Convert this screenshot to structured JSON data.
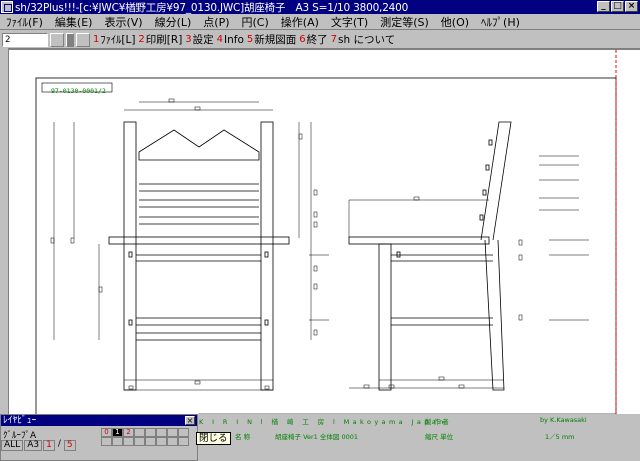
{
  "titlebar": {
    "title": "sh/32Plus!!!-[c:¥JWC¥楢野工房¥97_0130.JWC]胡座椅子　A3 S=1/10 3800,2400",
    "buttons": [
      "_",
      "□",
      "×"
    ]
  },
  "menu": [
    "ﾌｧｲﾙ(F)",
    "編集(E)",
    "表示(V)",
    "線分(L)",
    "点(P)",
    "円(C)",
    "操作(A)",
    "文字(T)",
    "測定等(S)",
    "他(O)",
    "ﾍﾙﾌﾟ(H)"
  ],
  "toolbar": {
    "layer_value": "2 ···········",
    "function_keys": [
      {
        "num": "1",
        "label": "ﾌｧｲﾙ[L]"
      },
      {
        "num": "2",
        "label": "印刷[R]"
      },
      {
        "num": "3",
        "label": "設定"
      },
      {
        "num": "4",
        "label": "Info"
      },
      {
        "num": "5",
        "label": "新規図面"
      },
      {
        "num": "6",
        "label": "終了"
      },
      {
        "num": "7",
        "label": "sh について"
      }
    ]
  },
  "drawing": {
    "id": "97-0130-0001/2",
    "titleblock": {
      "row1": "K I R I N   l  楢 崎 工 房  l   Makoyama Japan",
      "designer_label": "製 作 者",
      "designer": "by K.Kawasaki",
      "name_label": "名  称",
      "name": "胡座椅子  Ver1   全体図  0001",
      "scale_label": "縮尺  単位",
      "scale": "1／5   mm"
    }
  },
  "layer_panel": {
    "title": "ﾚｲﾔﾋﾞｭｰ",
    "group_label": "ｸﾞﾙｰﾌﾟA",
    "all_label": "ALL",
    "paper": "A3",
    "cur": "1",
    "slash": "/",
    "max": "5",
    "grid_top": [
      "0",
      "1",
      "2",
      "",
      "",
      "",
      "",
      ""
    ],
    "grid_bottom": [
      "",
      "",
      "",
      "",
      "",
      "",
      "",
      ""
    ]
  },
  "tooltip": "閉じる",
  "colors": {
    "titlebar": "#000080",
    "drawing_text": "#008000",
    "red_marker": "#d00000"
  }
}
